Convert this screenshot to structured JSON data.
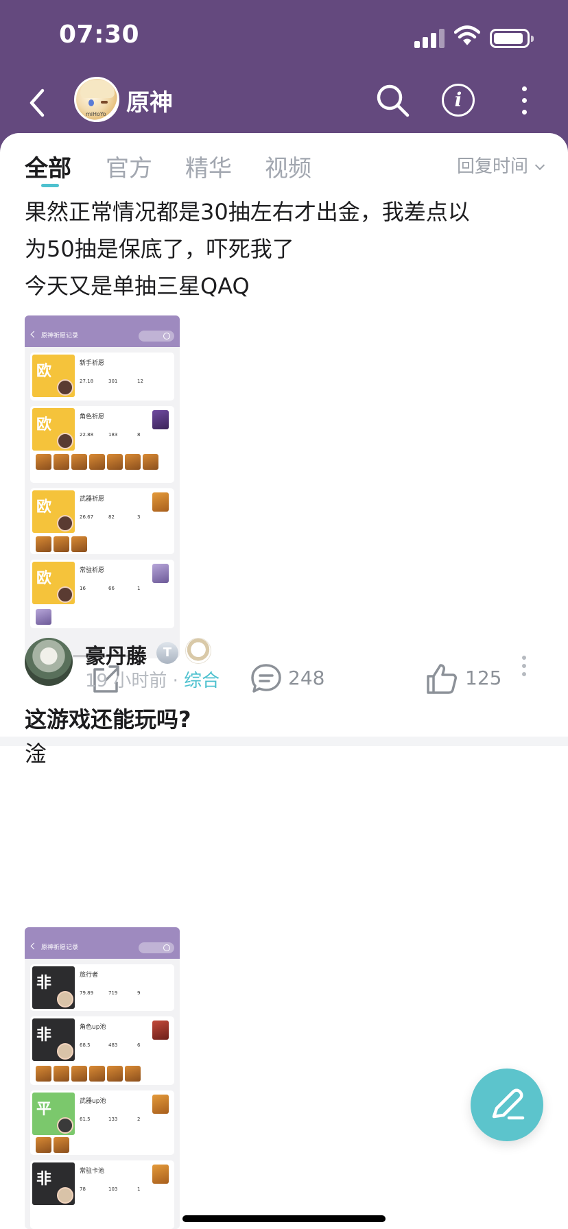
{
  "status_bar": {
    "time": "07:30"
  },
  "nav": {
    "app_name": "原神",
    "avatar_tag": "miHoYo"
  },
  "tabs": [
    {
      "label": "全部",
      "active": true
    },
    {
      "label": "官方",
      "active": false
    },
    {
      "label": "精华",
      "active": false
    },
    {
      "label": "视频",
      "active": false
    }
  ],
  "sort_label": "回复时间",
  "post1": {
    "lines": [
      "果然正常情况都是30抽左右才出金，我差点以",
      "为50抽是保底了，吓死我了",
      "今天又是单抽三星QAQ"
    ],
    "comments": "248",
    "likes": "125",
    "thumb": {
      "title": "原神祈愿记录",
      "cards": [
        {
          "badge": "欧",
          "title": "新手祈愿",
          "stats": [
            "27.18",
            "301",
            "12"
          ]
        },
        {
          "badge": "欧",
          "title": "角色祈愿",
          "stats": [
            "22.88",
            "183",
            "8"
          ]
        },
        {
          "badge": "欧",
          "title": "武器祈愿",
          "stats": [
            "26.67",
            "82",
            "3"
          ]
        },
        {
          "badge": "欧",
          "title": "常驻祈愿",
          "stats": [
            "16",
            "66",
            "1"
          ]
        }
      ]
    }
  },
  "post2": {
    "author": "豪丹藤",
    "level_badge": "T",
    "time": "19 小时前",
    "separator": "·",
    "category": "综合",
    "title": "这游戏还能玩吗?",
    "body": "淦",
    "thumb": {
      "title": "原神祈愿记录",
      "cards": [
        {
          "badge": "非",
          "title": "旅行者",
          "stats": [
            "79.89",
            "719",
            "9"
          ]
        },
        {
          "badge": "非",
          "title": "角色up池",
          "stats": [
            "68.5",
            "483",
            "6"
          ]
        },
        {
          "badge": "平",
          "title": "武器up池",
          "stats": [
            "61.5",
            "133",
            "2"
          ]
        },
        {
          "badge": "非",
          "title": "常驻卡池",
          "stats": [
            "78",
            "103",
            "1"
          ]
        }
      ]
    }
  },
  "colors": {
    "header": "#64497e",
    "accent": "#4ec1cf",
    "fab": "#5cc4cc"
  },
  "icons": [
    "back-icon",
    "search-icon",
    "info-icon",
    "more-icon",
    "share-icon",
    "comment-icon",
    "like-icon",
    "edit-icon"
  ]
}
